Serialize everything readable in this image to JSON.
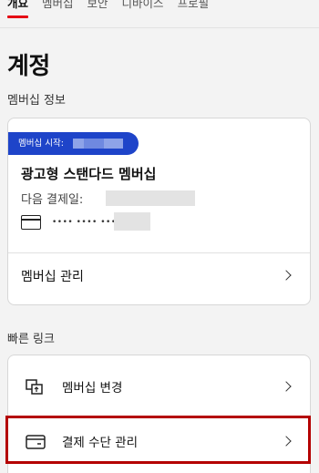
{
  "tabs": {
    "overview": "개요",
    "membership": "멤버십",
    "security": "보안",
    "devices": "디바이스",
    "profile": "프로필"
  },
  "page_title": "계정",
  "membership_section": {
    "label": "멤버십 정보",
    "badge_label": "멤버십 시작:",
    "plan_name": "광고형 스탠다드 멤버십",
    "next_billing_label": "다음 결제일:",
    "card_masked": "•••• •••• ••••",
    "manage_label": "멤버십 관리"
  },
  "quick_links": {
    "label": "빠른 링크",
    "items": [
      {
        "label": "멤버십 변경",
        "icon": "swap-membership-icon"
      },
      {
        "label": "결제 수단 관리",
        "icon": "credit-card-icon"
      }
    ]
  },
  "colors": {
    "accent_red": "#e50914",
    "badge_blue": "#1e44c9",
    "highlight_red": "#b40000"
  }
}
